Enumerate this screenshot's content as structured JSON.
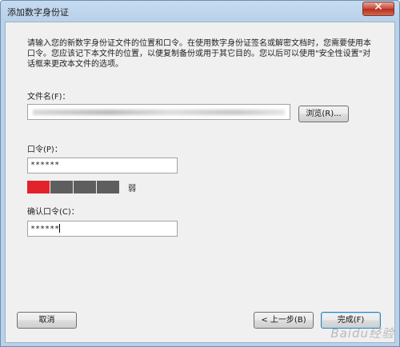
{
  "window": {
    "title": "添加数字身份证",
    "close_glyph": "✕"
  },
  "description": "请输入您的新数字身份证文件的位置和口令。在使用数字身份证签名或解密文档时，您需要使用本口令。您应该记下本文件的位置，以便复制备份或用于其它目的。您以后可以使用\"安全性设置\"对话框来更改本文件的选项。",
  "file": {
    "label": "文件名(F)：",
    "value": "",
    "browse_label": "浏览(R)..."
  },
  "password": {
    "label": "口令(P)：",
    "value": "******"
  },
  "strength": {
    "label": "弱",
    "filled_segments": 1,
    "total_segments": 5,
    "fill_color": "#e3232c",
    "empty_color": "#5e5e5e"
  },
  "confirm": {
    "label": "确认口令(C)：",
    "value": "******"
  },
  "buttons": {
    "cancel": "取消",
    "back": "< 上一步(B)",
    "finish": "完成(F)"
  },
  "watermark": "Baidu经验"
}
